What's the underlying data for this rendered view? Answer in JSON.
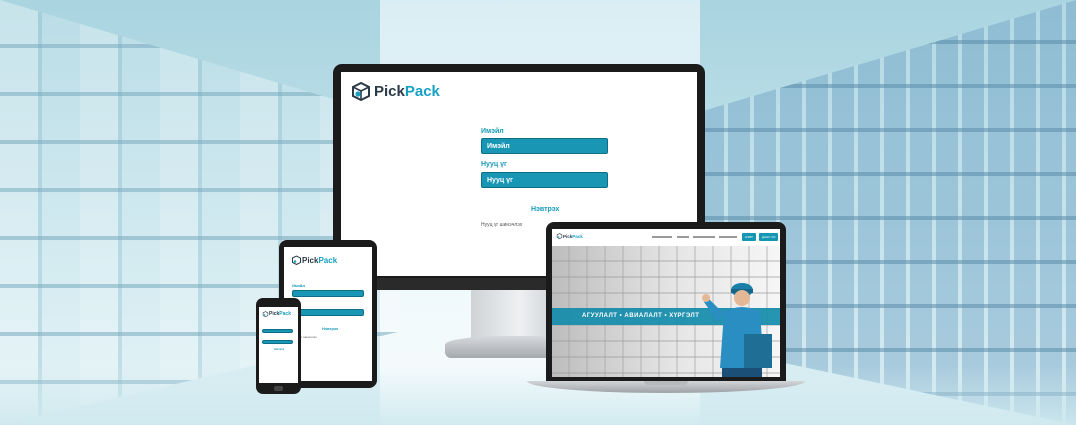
{
  "brand": {
    "name_part1": "Pick",
    "name_part2": "Pack"
  },
  "login": {
    "email_label": "Имэйл",
    "email_placeholder": "Имэйл",
    "password_label": "Нууц үг",
    "password_placeholder": "Нууц үг",
    "submit_label": "Нэвтрэх",
    "forgot_label": "Нууц үг шинэчлэх"
  },
  "landing": {
    "hero_text": "АГУУЛАЛТ • АВИАЛАЛТ • ХҮРГЭЛТ",
    "nav_pills": [
      "НЭВТ",
      "ДАНС ЧИ"
    ]
  },
  "colors": {
    "accent": "#1896b3",
    "bg": "#bfe0ea"
  }
}
